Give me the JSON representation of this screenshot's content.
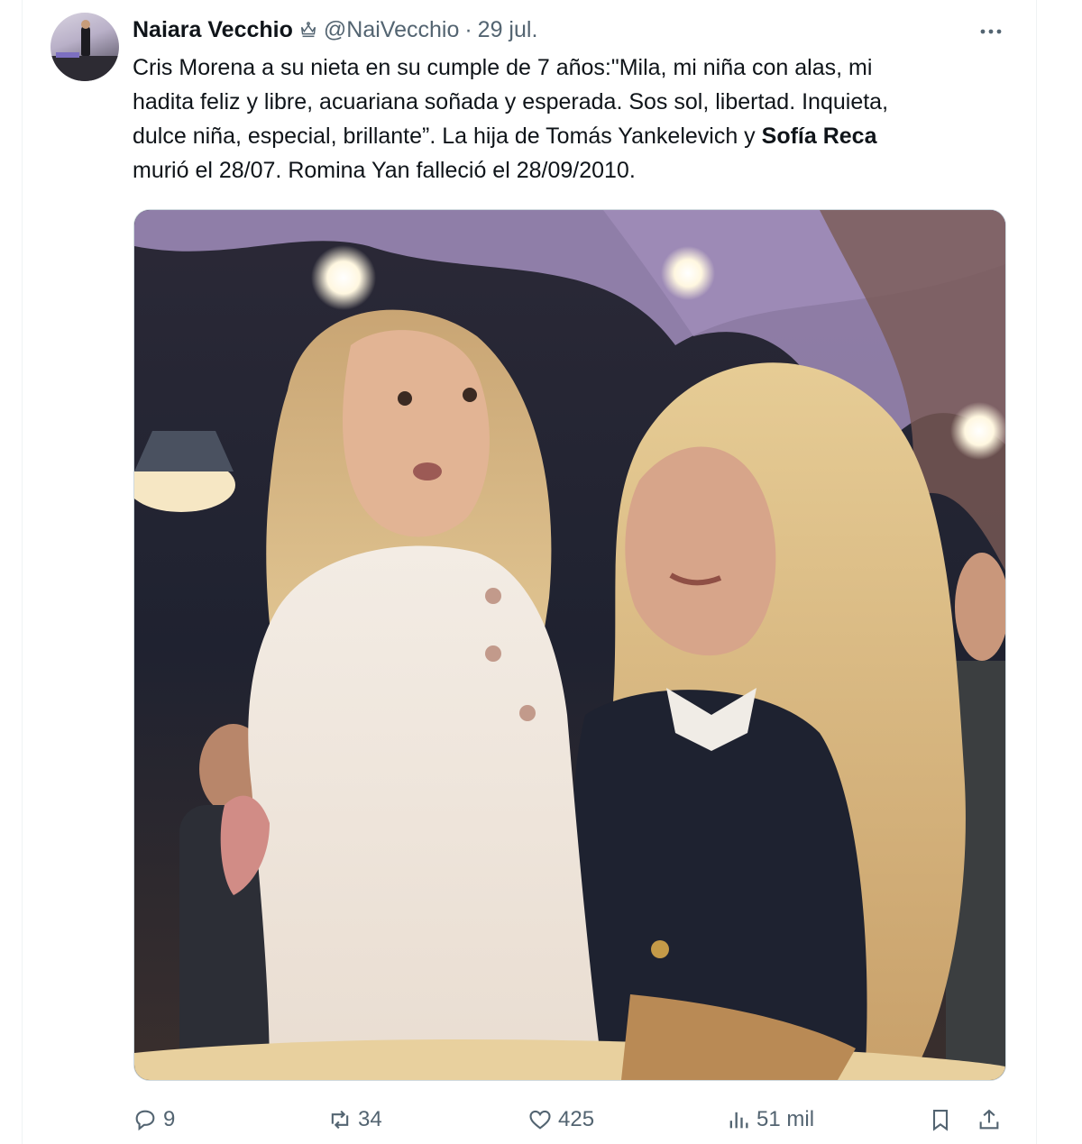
{
  "tweet": {
    "author_name": "Naiara Vecchio",
    "handle": "@NaiVecchio",
    "separator": "·",
    "date": "29 jul.",
    "more_label": "···",
    "text_lines": [
      "Cris Morena a su nieta en su cumple de 7 años:\"Mila, mi niña con alas, mi",
      "hadita feliz y libre, acuariana soñada y esperada. Sos sol, libertad. Inquieta,",
      "dulce niña, especial, brillante”. La hija de Tomás Yankelevich y "
    ],
    "text_bold": "Sofía Reca",
    "text_last_line": "murió el 28/07. Romina Yan falleció el 28/09/2010.",
    "media_description_icon": "photo-icon"
  },
  "actions": {
    "replies": "9",
    "reposts": "34",
    "likes": "425",
    "views": "51 mil"
  },
  "colors": {
    "text": "#0f1419",
    "secondary": "#536471",
    "border": "#cfd9de"
  }
}
